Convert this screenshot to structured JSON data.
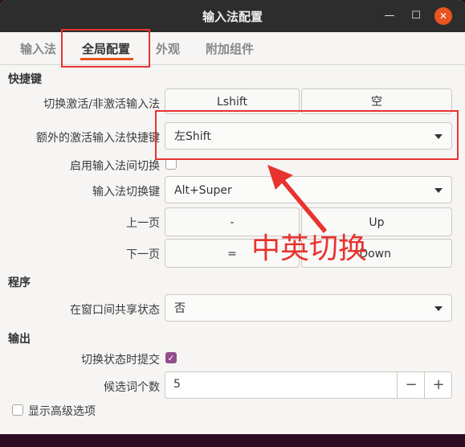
{
  "window": {
    "title": "输入法配置"
  },
  "tabs": [
    {
      "label": "输入法"
    },
    {
      "label": "全局配置"
    },
    {
      "label": "外观"
    },
    {
      "label": "附加组件"
    }
  ],
  "sections": {
    "hotkeys": "快捷键",
    "program": "程序",
    "output": "输出"
  },
  "hotkeys": {
    "toggle_label": "切换激活/非激活输入法",
    "toggle_key1": "Lshift",
    "toggle_key2": "空",
    "extra_label": "额外的激活输入法快捷键",
    "extra_value": "左Shift",
    "enable_switch_label": "启用输入法间切换",
    "switch_key_label": "输入法切换键",
    "switch_key_value": "Alt+Super",
    "prev_page_label": "上一页",
    "prev_key1": "-",
    "prev_key2": "Up",
    "next_page_label": "下一页",
    "next_key1": "=",
    "next_key2": "Down"
  },
  "program": {
    "share_label": "在窗口间共享状态",
    "share_value": "否"
  },
  "output": {
    "commit_label": "切换状态时提交",
    "candidates_label": "候选词个数",
    "candidates_value": "5",
    "minus": "−",
    "plus": "+"
  },
  "advanced_label": "显示高级选项",
  "annotation": {
    "text": "中英切换",
    "color": "#e8332e"
  },
  "colors": {
    "accent": "#e95420",
    "checkbox": "#924d8b"
  }
}
